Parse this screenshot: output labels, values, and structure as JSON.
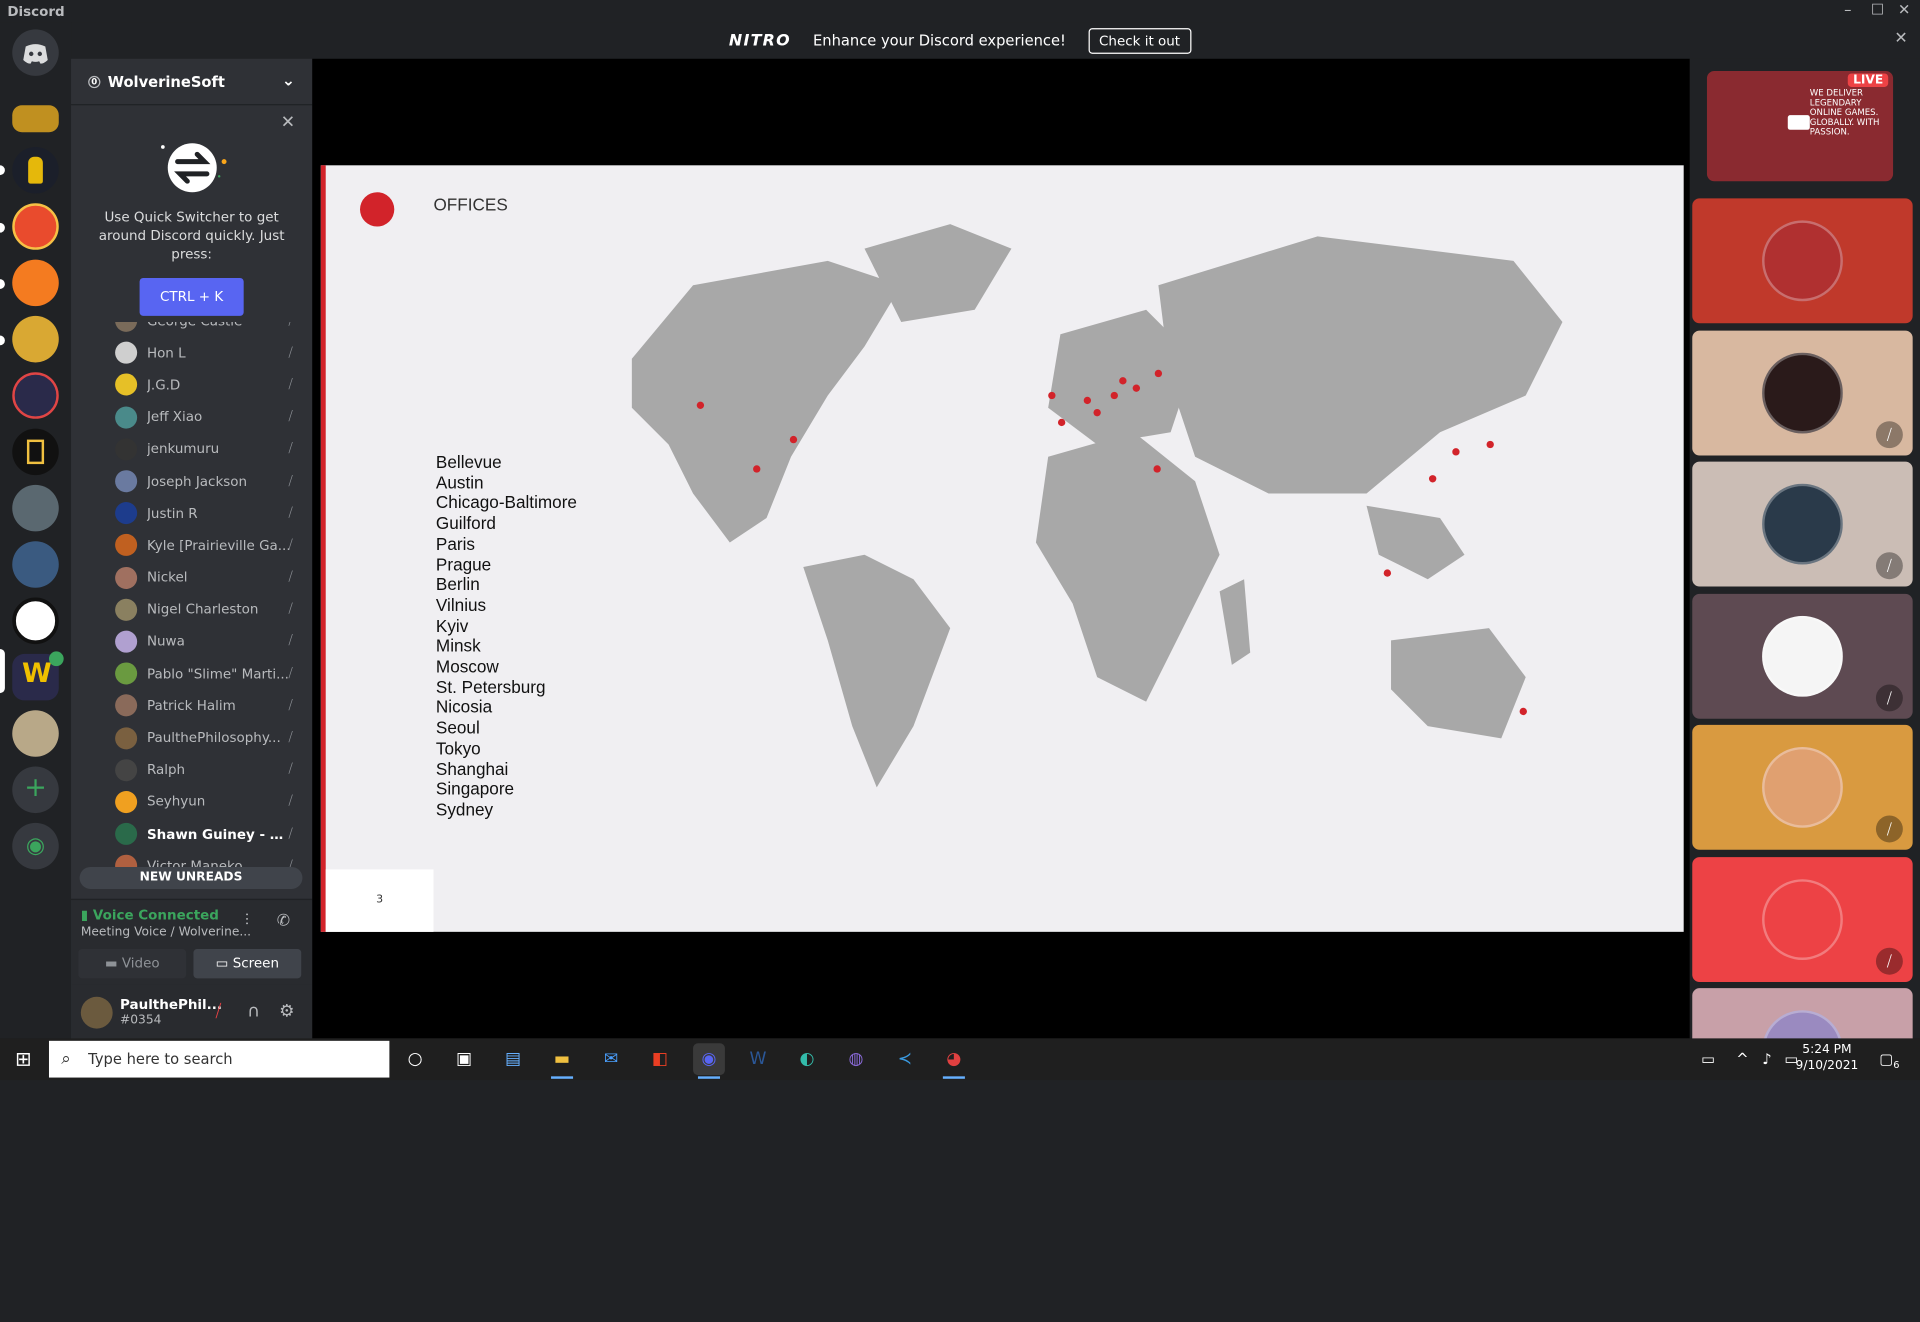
{
  "window": {
    "app_name": "Discord",
    "min": "–",
    "max": "☐",
    "close": "✕"
  },
  "nitro": {
    "logo": "NITRO",
    "text": "Enhance your Discord experience!",
    "button": "Check it out",
    "close": "✕"
  },
  "server": {
    "name": "WolverineSoft",
    "chevron": "⌄"
  },
  "quick_switcher": {
    "text": "Use Quick Switcher to get around Discord quickly. Just press:",
    "button": "CTRL + K",
    "close": "✕"
  },
  "members": [
    {
      "name": "George Castle",
      "color": "#7a6b5a"
    },
    {
      "name": "Hon L",
      "color": "#cfcfcf"
    },
    {
      "name": "J.G.D",
      "color": "#e6c027"
    },
    {
      "name": "Jeff Xiao",
      "color": "#4a8a8a"
    },
    {
      "name": "jenkumuru",
      "color": "#333333"
    },
    {
      "name": "Joseph Jackson",
      "color": "#6a7aa0"
    },
    {
      "name": "Justin R",
      "color": "#1d3c8c"
    },
    {
      "name": "Kyle [Prairieville Ga...",
      "color": "#c06020"
    },
    {
      "name": "Nickel",
      "color": "#a07060"
    },
    {
      "name": "Nigel Charleston",
      "color": "#8a8060"
    },
    {
      "name": "Nuwa",
      "color": "#b0a0d0"
    },
    {
      "name": "Pablo \"Slime\" Marti...",
      "color": "#6a9a40"
    },
    {
      "name": "Patrick Halim",
      "color": "#8a6a5a"
    },
    {
      "name": "PaulthePhilosophy...",
      "color": "#7a6040"
    },
    {
      "name": "Ralph",
      "color": "#444444"
    },
    {
      "name": "Seyhyun",
      "color": "#f0a020"
    },
    {
      "name": "Shawn Guiney - Warga...",
      "color": "#2a6a4a",
      "bold": true
    },
    {
      "name": "Victor Maneko",
      "color": "#b06040"
    }
  ],
  "new_unreads": "NEW UNREADS",
  "voice": {
    "status": "Voice Connected",
    "channel": "Meeting Voice / Wolverine...",
    "video": "Video",
    "screen": "Screen"
  },
  "user": {
    "name": "PaulthePhil...",
    "tag": "#0354"
  },
  "slide": {
    "title": "OFFICES",
    "page": "3",
    "cities": [
      "Bellevue",
      "Austin",
      "Chicago-Baltimore",
      "Guilford",
      "Paris",
      "Prague",
      "Berlin",
      "Vilnius",
      "Kyiv",
      "Minsk",
      "Moscow",
      "St. Petersburg",
      "Nicosia",
      "Seoul",
      "Tokyo",
      "Shanghai",
      "Singapore",
      "Sydney"
    ]
  },
  "tiles": [
    {
      "kind": "live",
      "badge": "LIVE",
      "text": "WE DELIVER LEGENDARY ONLINE GAMES. GLOBALLY. WITH PASSION.",
      "bg": "#8a2a30"
    },
    {
      "kind": "avatar",
      "bg": "#c0392b",
      "av": "#b03030",
      "muted": false
    },
    {
      "kind": "avatar",
      "bg": "#d8b8a0",
      "av": "#2a1a1a",
      "muted": true
    },
    {
      "kind": "avatar",
      "bg": "#cbbdb5",
      "av": "#2a3a4a",
      "muted": true
    },
    {
      "kind": "avatar",
      "bg": "#5e4a52",
      "av": "#f5f5f5",
      "muted": true
    },
    {
      "kind": "avatar",
      "bg": "#d99a40",
      "av": "#e0a070",
      "muted": true
    },
    {
      "kind": "avatar",
      "bg": "#ed4245",
      "av": "#ed4245",
      "muted": true
    },
    {
      "kind": "avatar",
      "bg": "#c8a0a8",
      "av": "#9a8ac0",
      "muted": false
    }
  ],
  "taskbar": {
    "search_placeholder": "Type here to search",
    "time": "5:24 PM",
    "date": "9/10/2021",
    "notif": "6"
  }
}
